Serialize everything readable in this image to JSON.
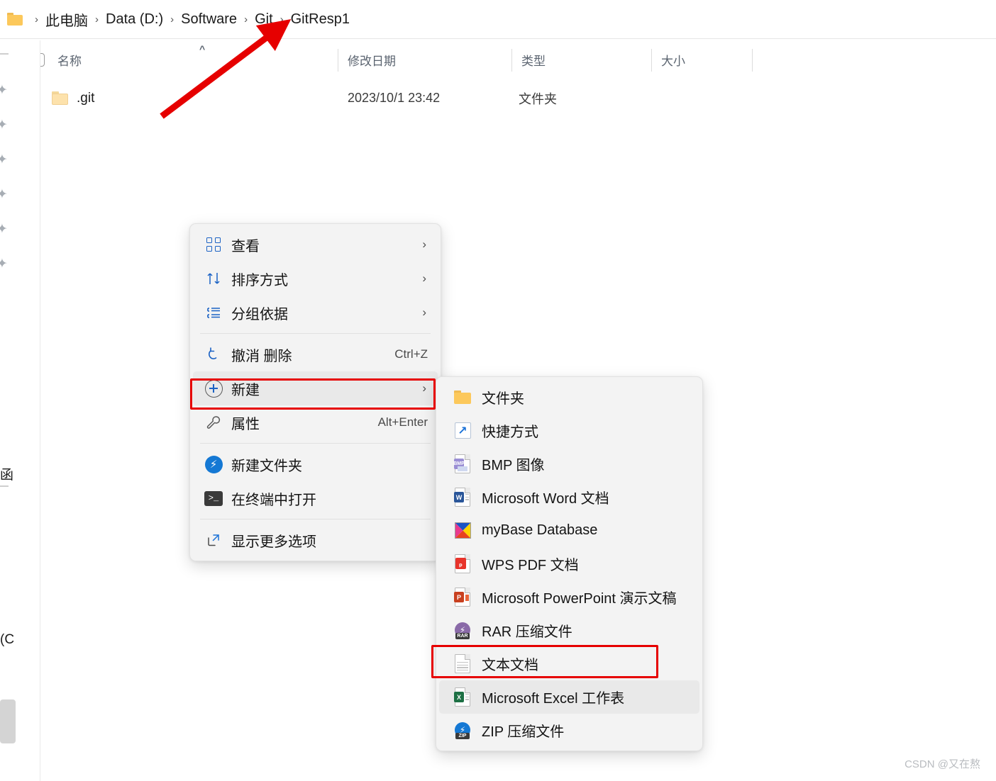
{
  "breadcrumb": {
    "folder_icon": "folder-icon",
    "items": [
      "此电脑",
      "Data (D:)",
      "Software",
      "Git",
      "GitResp1"
    ],
    "separator": "›"
  },
  "columns": [
    {
      "label": "名称",
      "sort_indicator": "^"
    },
    {
      "label": "修改日期",
      "sort_indicator": ""
    },
    {
      "label": "类型",
      "sort_indicator": ""
    },
    {
      "label": "大小",
      "sort_indicator": ""
    }
  ],
  "files": [
    {
      "name": ".git",
      "date_modified": "2023/10/1 23:42",
      "type": "文件夹",
      "size": ""
    }
  ],
  "context_menu": {
    "items": [
      {
        "icon": "grid-view-icon",
        "label": "查看",
        "accel": "",
        "chevron": "›",
        "hover": false,
        "highlight": false
      },
      {
        "icon": "sort-icon",
        "label": "排序方式",
        "accel": "",
        "chevron": "›",
        "hover": false,
        "highlight": false
      },
      {
        "icon": "group-by-icon",
        "label": "分组依据",
        "accel": "",
        "chevron": "›",
        "hover": false,
        "highlight": false
      },
      {
        "icon": "separator",
        "label": "",
        "accel": "",
        "chevron": "",
        "hover": false,
        "highlight": false
      },
      {
        "icon": "undo-icon",
        "label": "撤消 删除",
        "accel": "Ctrl+Z",
        "chevron": "",
        "hover": false,
        "highlight": false
      },
      {
        "icon": "plus-circle-icon",
        "label": "新建",
        "accel": "",
        "chevron": "›",
        "hover": true,
        "highlight": true
      },
      {
        "icon": "wrench-icon",
        "label": "属性",
        "accel": "Alt+Enter",
        "chevron": "",
        "hover": false,
        "highlight": false
      },
      {
        "icon": "separator",
        "label": "",
        "accel": "",
        "chevron": "",
        "hover": false,
        "highlight": false
      },
      {
        "icon": "bandizip-icon",
        "label": "新建文件夹",
        "accel": "",
        "chevron": "",
        "hover": false,
        "highlight": false
      },
      {
        "icon": "terminal-icon",
        "label": "在终端中打开",
        "accel": "",
        "chevron": "",
        "hover": false,
        "highlight": false
      },
      {
        "icon": "separator",
        "label": "",
        "accel": "",
        "chevron": "",
        "hover": false,
        "highlight": false
      },
      {
        "icon": "show-more-icon",
        "label": "显示更多选项",
        "accel": "",
        "chevron": "",
        "hover": false,
        "highlight": false
      }
    ]
  },
  "submenu": {
    "items": [
      {
        "icon": "folder-icon",
        "label": "文件夹",
        "hover": false,
        "highlight": false
      },
      {
        "icon": "shortcut-icon",
        "label": "快捷方式",
        "hover": false,
        "highlight": false
      },
      {
        "icon": "bmp-image-icon",
        "label": "BMP 图像",
        "hover": false,
        "highlight": false
      },
      {
        "icon": "word-icon",
        "label": "Microsoft Word 文档",
        "hover": false,
        "highlight": false
      },
      {
        "icon": "mybase-icon",
        "label": "myBase Database",
        "hover": false,
        "highlight": false
      },
      {
        "icon": "wps-pdf-icon",
        "label": "WPS PDF 文档",
        "hover": false,
        "highlight": false
      },
      {
        "icon": "powerpoint-icon",
        "label": "Microsoft PowerPoint 演示文稿",
        "hover": false,
        "highlight": false
      },
      {
        "icon": "rar-icon",
        "label": "RAR 压缩文件",
        "hover": false,
        "highlight": false
      },
      {
        "icon": "text-document-icon",
        "label": "文本文档",
        "hover": false,
        "highlight": true
      },
      {
        "icon": "excel-icon",
        "label": "Microsoft Excel 工作表",
        "hover": true,
        "highlight": false
      },
      {
        "icon": "zip-icon",
        "label": "ZIP 压缩文件",
        "hover": false,
        "highlight": false
      }
    ]
  },
  "annotations": {
    "arrow": {
      "name": "red-arrow",
      "color": "#e60000",
      "points_to": "GitResp1"
    },
    "boxes": [
      {
        "name": "redbox-new-item",
        "color": "#e60000",
        "target": "新建"
      },
      {
        "name": "redbox-text-document",
        "color": "#e60000",
        "target": "文本文档"
      }
    ]
  },
  "edge_fragments": {
    "text1": "函",
    "text2": "(C"
  },
  "watermark": "CSDN @又在熬",
  "colors": {
    "accent": "#1b62c4",
    "annotation": "#e60000",
    "menu_bg": "#f3f3f3",
    "hover_bg": "#e9e9e9",
    "folder_yellow": "#fcc85b"
  }
}
